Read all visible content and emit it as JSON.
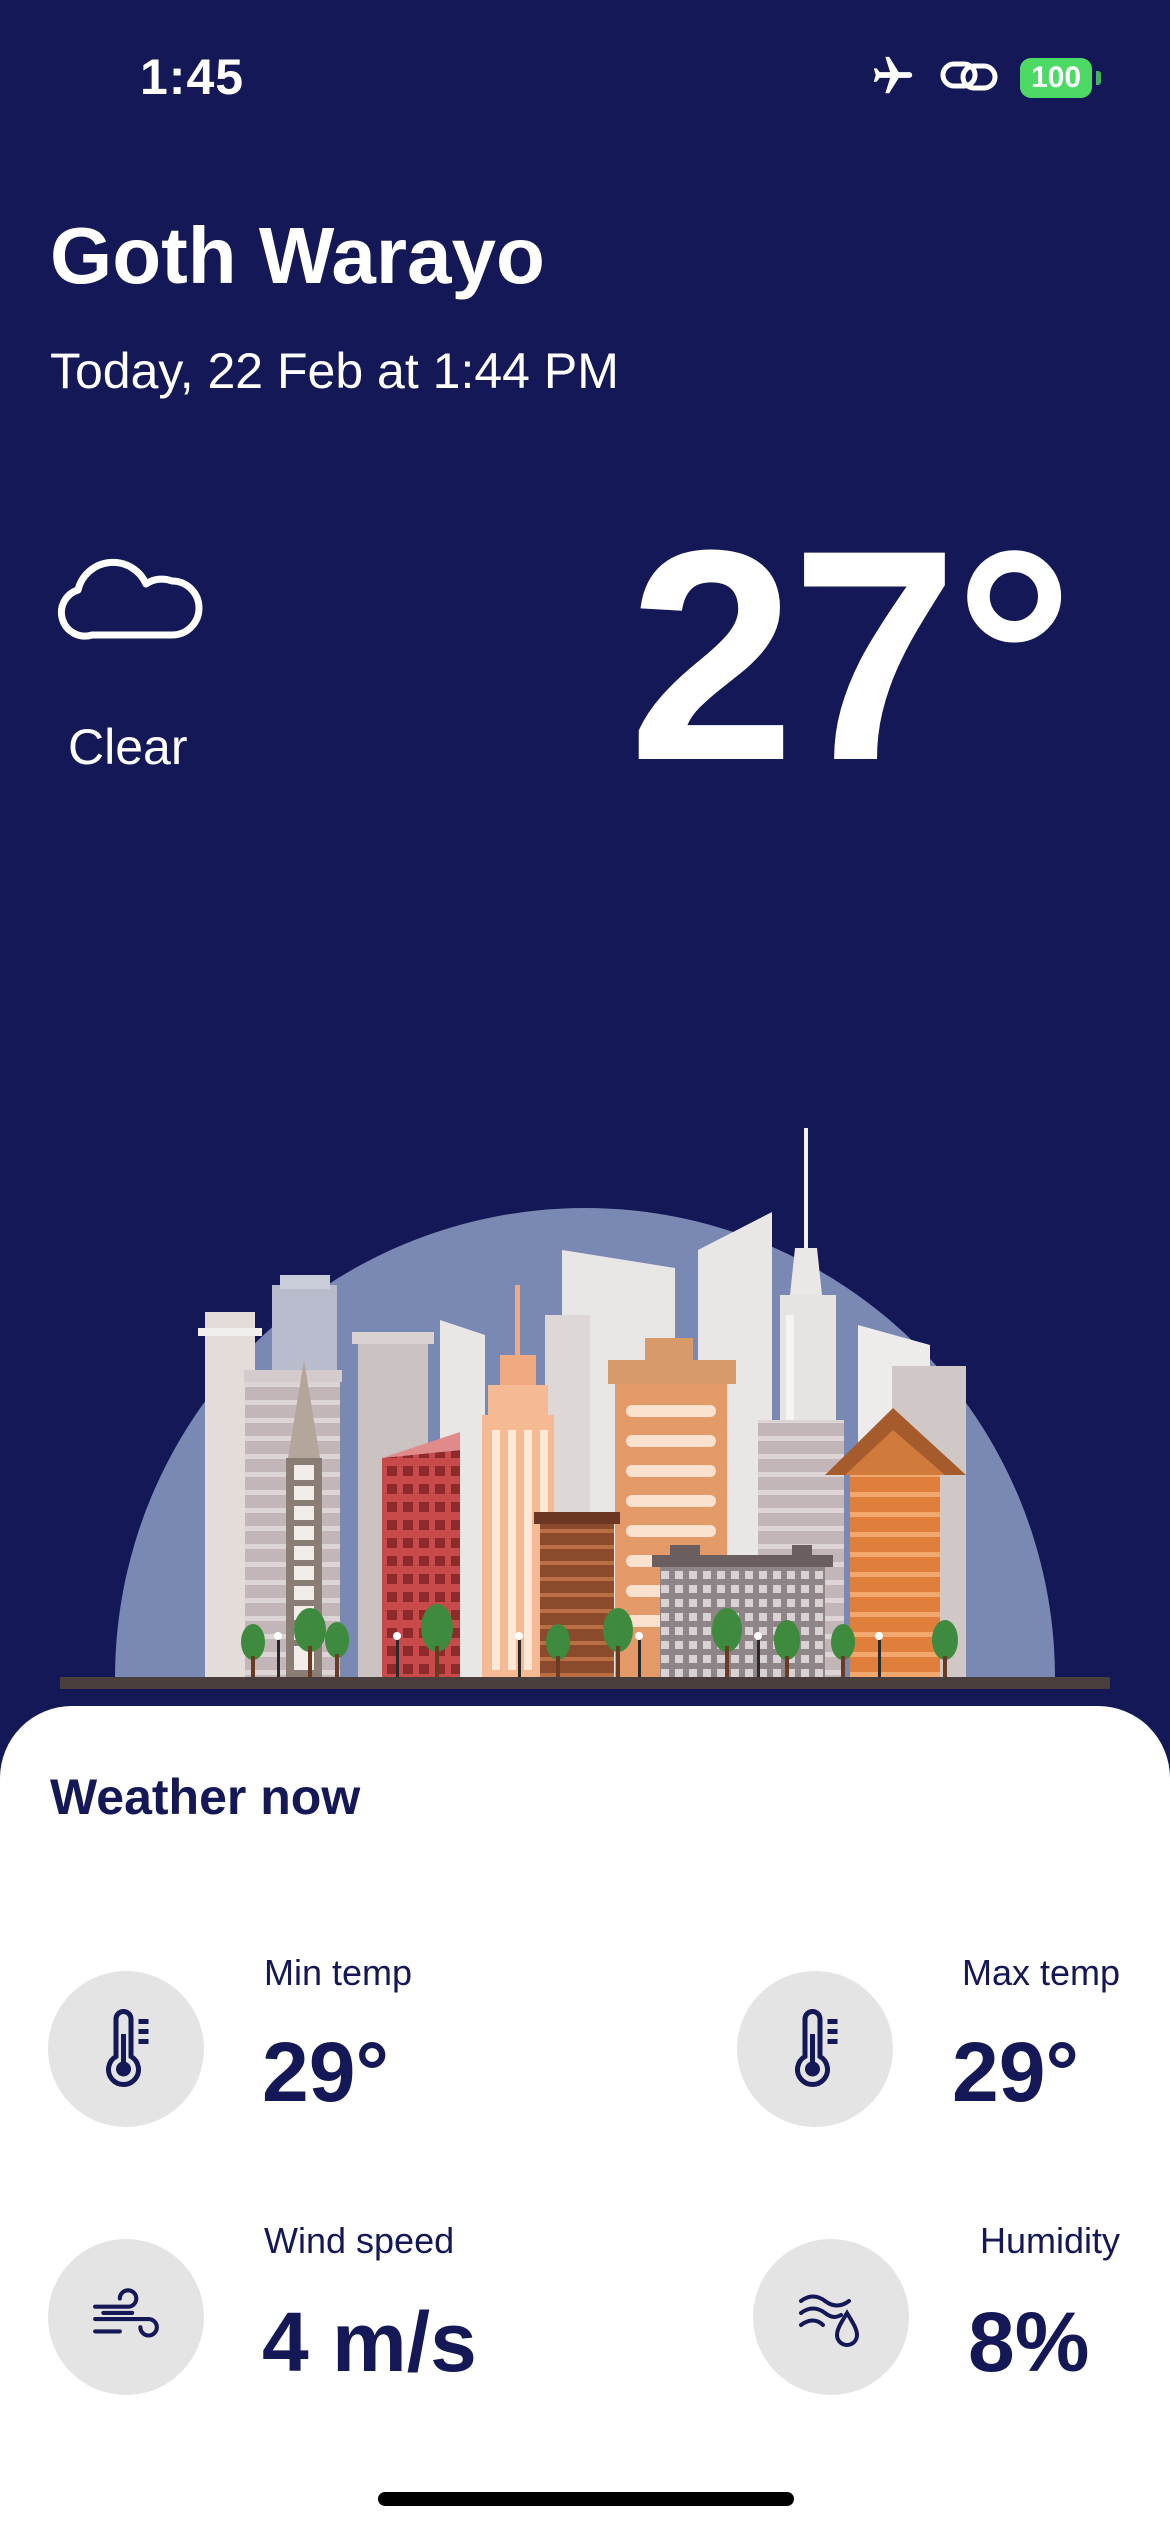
{
  "status_bar": {
    "time": "1:45",
    "battery": "100",
    "icons": [
      "airplane-icon",
      "link-icon",
      "battery-icon"
    ]
  },
  "location": {
    "city": "Goth Warayo",
    "date": "Today, 22 Feb at 1:44 PM"
  },
  "current": {
    "condition": "Clear",
    "condition_icon": "cloud-icon",
    "temperature": "27°"
  },
  "weather_now": {
    "title": "Weather now",
    "metrics": [
      {
        "label": "Min temp",
        "value": "29°",
        "icon": "thermometer-icon"
      },
      {
        "label": "Max temp",
        "value": "29°",
        "icon": "thermometer-icon"
      },
      {
        "label": "Wind speed",
        "value": "4 m/s",
        "icon": "wind-icon"
      },
      {
        "label": "Humidity",
        "value": "8%",
        "icon": "humidity-icon"
      }
    ]
  },
  "colors": {
    "background": "#141856",
    "card": "#ffffff",
    "text_dark": "#141856",
    "icon_circle": "#e4e4e4",
    "battery": "#4cd964",
    "sky_dome": "#7a88b4"
  }
}
